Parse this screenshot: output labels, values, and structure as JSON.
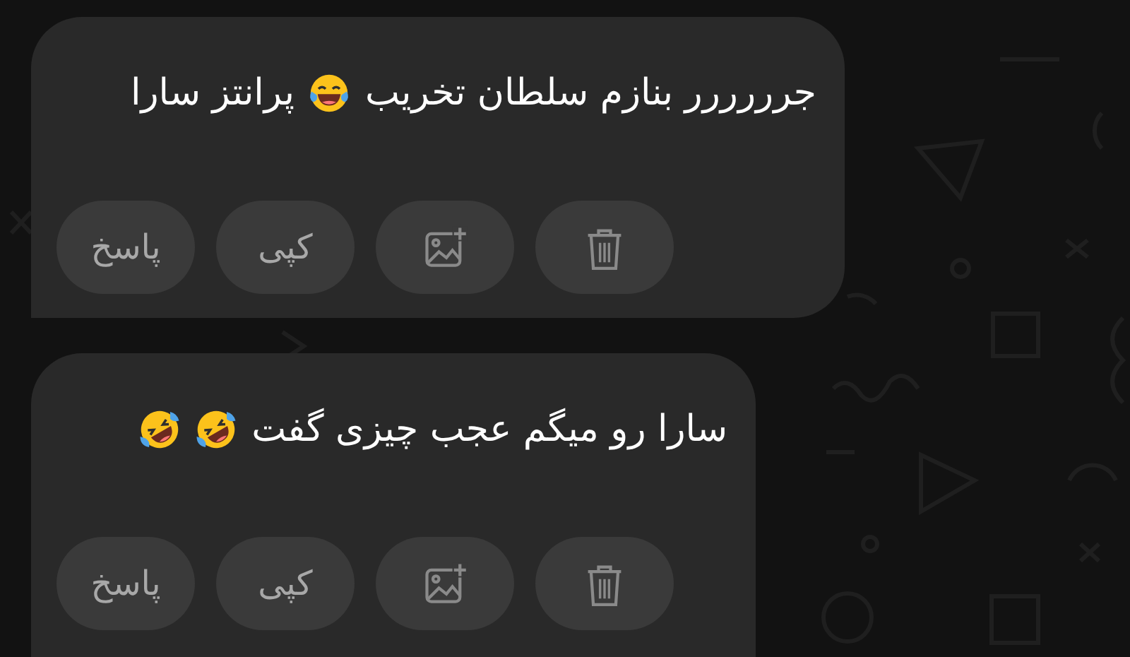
{
  "messages": [
    {
      "parts": [
        {
          "kind": "text",
          "text": "جرررررر بنازم سلطان تخریب"
        },
        {
          "kind": "tears-of-joy"
        },
        {
          "kind": "text",
          "text": "پرانتز سارا"
        }
      ],
      "actions": [
        {
          "kind": "delete"
        },
        {
          "kind": "add-image"
        },
        {
          "kind": "copy",
          "label": "کپی"
        },
        {
          "kind": "reply",
          "label": "پاسخ"
        }
      ]
    },
    {
      "parts": [
        {
          "kind": "text",
          "text": "سارا رو میگم عجب چیزی گفت"
        },
        {
          "kind": "rolling-laughing"
        },
        {
          "kind": "rolling-laughing"
        }
      ],
      "actions": [
        {
          "kind": "delete"
        },
        {
          "kind": "add-image"
        },
        {
          "kind": "copy",
          "label": "کپی"
        },
        {
          "kind": "reply",
          "label": "پاسخ"
        }
      ]
    }
  ]
}
